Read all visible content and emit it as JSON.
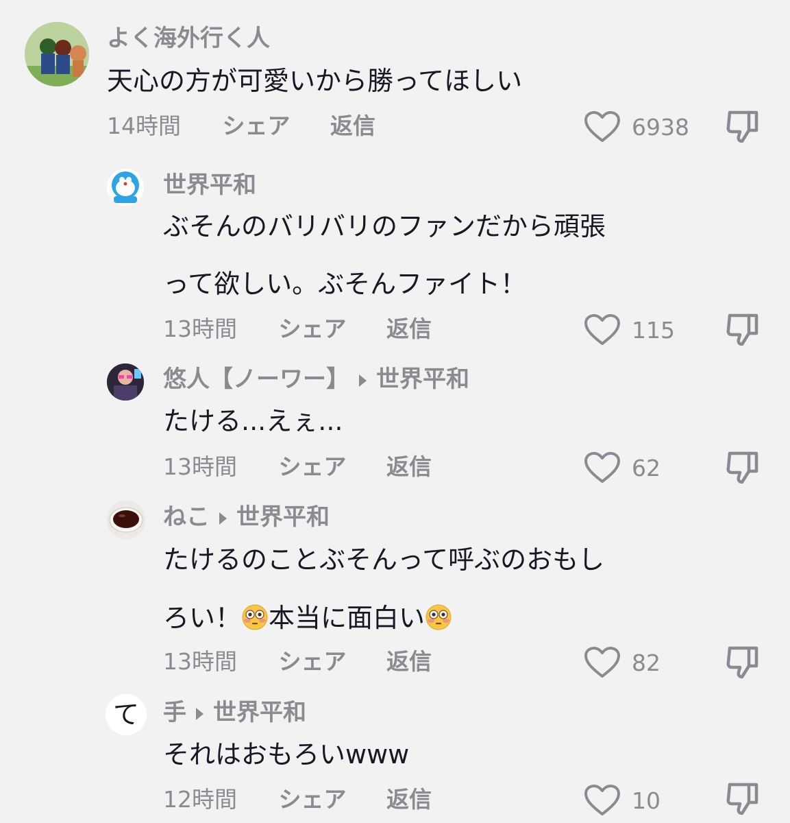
{
  "labels": {
    "share": "シェア",
    "reply": "返信"
  },
  "colors": {
    "background": "#f2f2f3",
    "meta": "#8a8b91",
    "text": "#161823"
  },
  "comments": [
    {
      "avatar_icon": "mario-luigi-avatar-icon",
      "username": "よく海外行く人",
      "text_lines": [
        "天心の方が可愛いから勝ってほしい"
      ],
      "time": "14時間",
      "likes": "6938"
    },
    {
      "avatar_icon": "doraemon-avatar-icon",
      "username": "世界平和",
      "text_lines": [
        "ぶそんのバリバリのファンだから頑張",
        "って欲しい。ぶそんファイト！"
      ],
      "time": "13時間",
      "likes": "115"
    },
    {
      "avatar_icon": "person-photo-avatar-icon",
      "username": "悠人【ノーワー】",
      "reply_to": "世界平和",
      "text_lines": [
        "たける...えぇ..."
      ],
      "time": "13時間",
      "likes": "62"
    },
    {
      "avatar_icon": "tea-cup-avatar-icon",
      "username": "ねこ",
      "reply_to": "世界平和",
      "text_lines": [
        "たけるのことぶそんって呼ぶのおもし"
      ],
      "text_line2_parts": [
        "ろい！",
        "本当に面白い"
      ],
      "time": "13時間",
      "likes": "82"
    },
    {
      "avatar_icon": "te-character-avatar-icon",
      "avatar_char": "て",
      "username": "手",
      "reply_to": "世界平和",
      "text_lines": [
        "それはおもろいwww"
      ],
      "time": "12時間",
      "likes": "10"
    }
  ]
}
